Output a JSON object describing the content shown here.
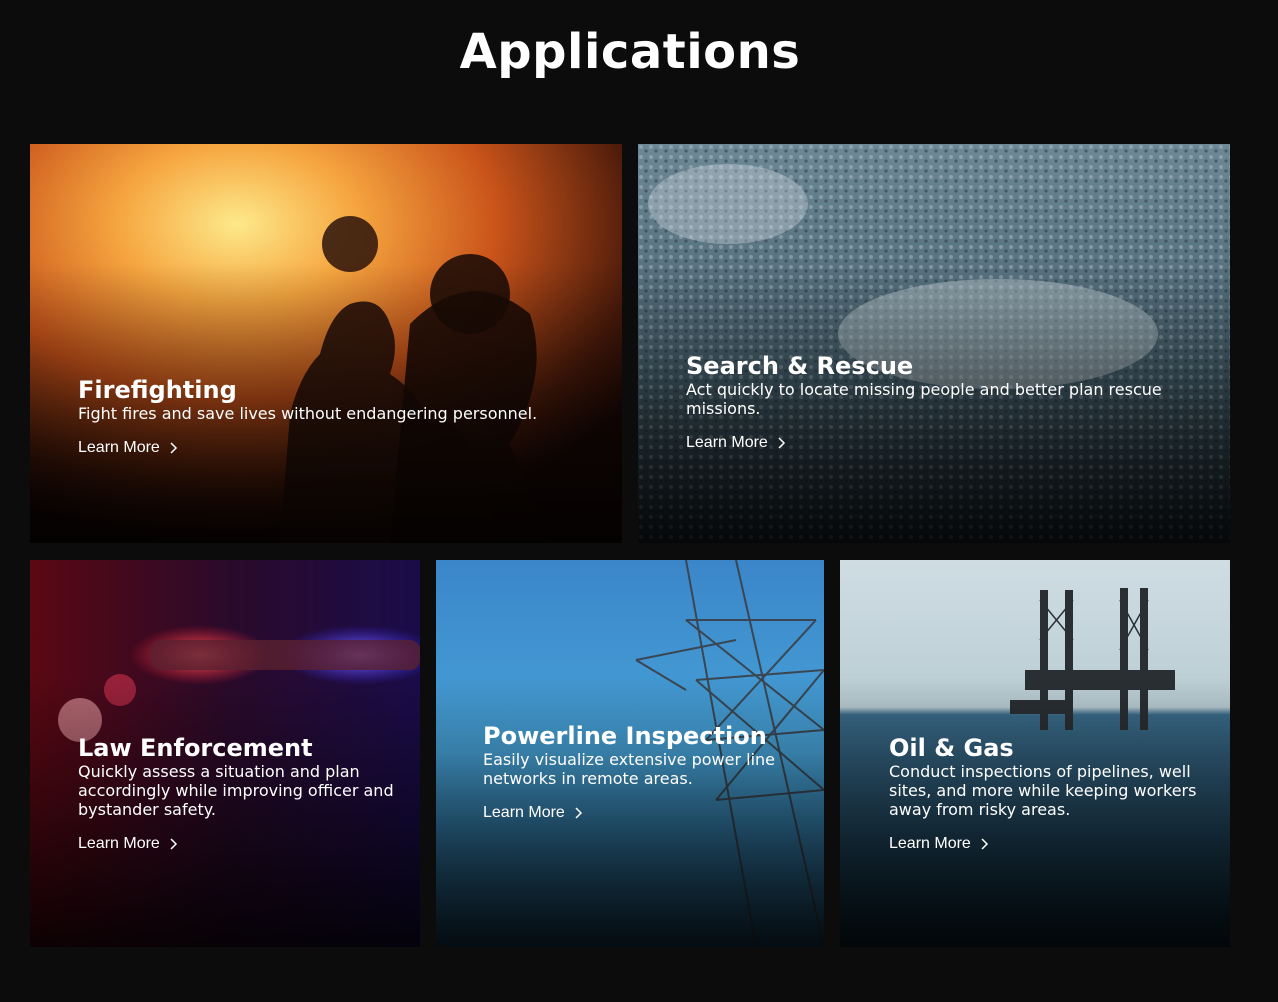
{
  "page": {
    "title": "Applications"
  },
  "cards": [
    {
      "id": "firefighting",
      "title": "Firefighting",
      "description": "Fight fires and save lives without endangering personnel.",
      "link": "Learn More"
    },
    {
      "id": "search-rescue",
      "title": "Search & Rescue",
      "description": "Act quickly to locate missing people and better plan rescue missions.",
      "link": "Learn More"
    },
    {
      "id": "law-enforcement",
      "title": "Law Enforcement",
      "description": "Quickly assess a situation and plan accordingly while improving officer and bystander safety.",
      "link": "Learn More"
    },
    {
      "id": "powerline",
      "title": "Powerline Inspection",
      "description": "Easily visualize extensive power line networks in remote areas.",
      "link": "Learn More"
    },
    {
      "id": "oil-gas",
      "title": "Oil & Gas",
      "description": "Conduct inspections of pipelines, well sites, and more while keeping workers away from risky areas.",
      "link": "Learn More"
    }
  ],
  "icons": {
    "link_arrow": "chevron-right-icon"
  },
  "colors": {
    "background": "#0c0c0c",
    "text": "#ffffff",
    "muted_text": "#d9d9d9"
  }
}
